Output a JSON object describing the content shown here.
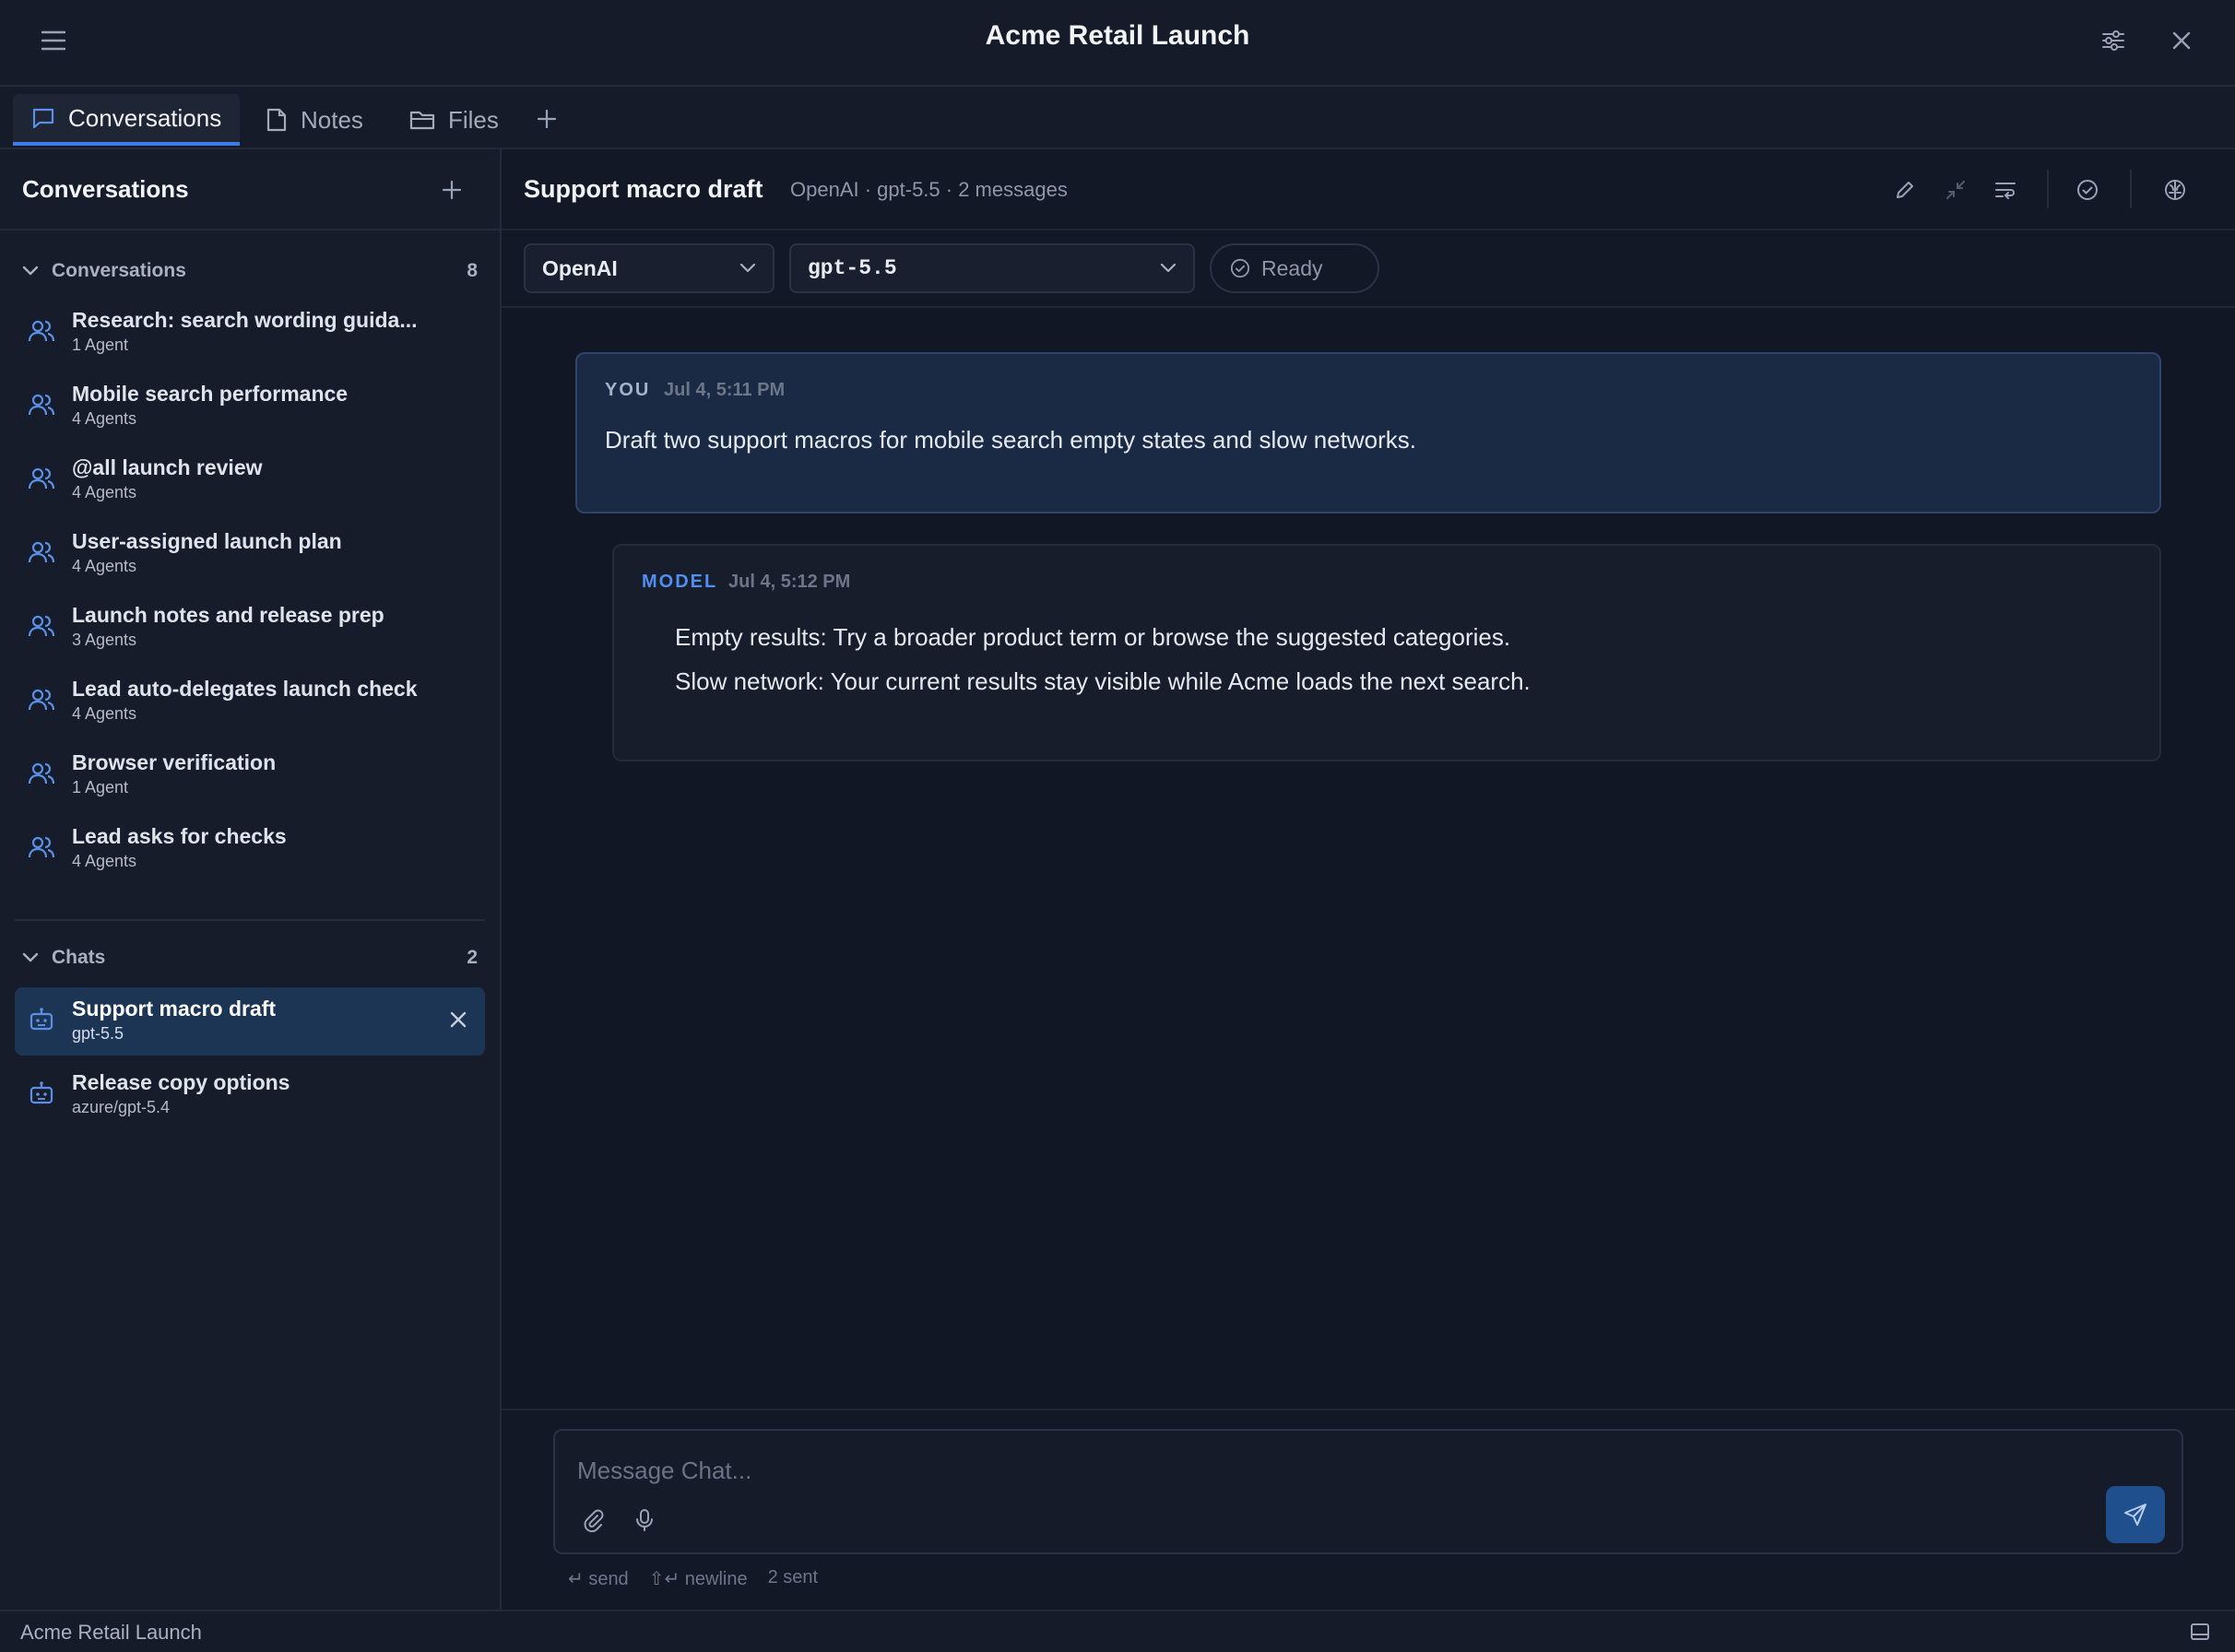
{
  "app": {
    "title": "Acme Retail Launch"
  },
  "tabs": [
    {
      "label": "Conversations",
      "icon": "chat-bubble-icon",
      "active": true
    },
    {
      "label": "Notes",
      "icon": "note-icon",
      "active": false
    },
    {
      "label": "Files",
      "icon": "folder-icon",
      "active": false
    }
  ],
  "sidebar": {
    "title": "Conversations",
    "sections": [
      {
        "label": "Conversations",
        "count": "8",
        "items": [
          {
            "name": "Research: search wording guida...",
            "sub": "1 Agent"
          },
          {
            "name": "Mobile search performance",
            "sub": "4 Agents"
          },
          {
            "name": "@all launch review",
            "sub": "4 Agents"
          },
          {
            "name": "User-assigned launch plan",
            "sub": "4 Agents"
          },
          {
            "name": "Launch notes and release prep",
            "sub": "3 Agents"
          },
          {
            "name": "Lead auto-delegates launch check",
            "sub": "4 Agents"
          },
          {
            "name": "Browser verification",
            "sub": "1 Agent"
          },
          {
            "name": "Lead asks for checks",
            "sub": "4 Agents"
          }
        ]
      },
      {
        "label": "Chats",
        "count": "2",
        "items": [
          {
            "name": "Support macro draft",
            "sub": "gpt-5.5",
            "selected": true
          },
          {
            "name": "Release copy options",
            "sub": "azure/gpt-5.4"
          }
        ]
      }
    ]
  },
  "chat": {
    "title": "Support macro draft",
    "meta": "OpenAI · gpt-5.5 · 2 messages",
    "provider": "OpenAI",
    "model": "gpt-5.5",
    "status": "Ready",
    "messages": [
      {
        "role": "YOU",
        "time": "Jul 4, 5:11 PM",
        "lines": [
          "Draft two support macros for mobile search empty states and slow networks."
        ]
      },
      {
        "role": "MODEL",
        "time": "Jul 4, 5:12 PM",
        "lines": [
          "Empty results: Try a broader product term or browse the suggested categories.",
          "Slow network: Your current results stay visible while Acme loads the next search."
        ]
      }
    ]
  },
  "composer": {
    "placeholder": "Message Chat...",
    "hint_send": "↵ send",
    "hint_newline": "⇧↵ newline",
    "hint_sent": "2 sent"
  },
  "statusbar": {
    "text": "Acme Retail Launch"
  },
  "colors": {
    "accent": "#3f7be8",
    "selected_row": "#1d3554",
    "you_bubble": "#1b2a44",
    "model_label": "#4f8ff0"
  }
}
